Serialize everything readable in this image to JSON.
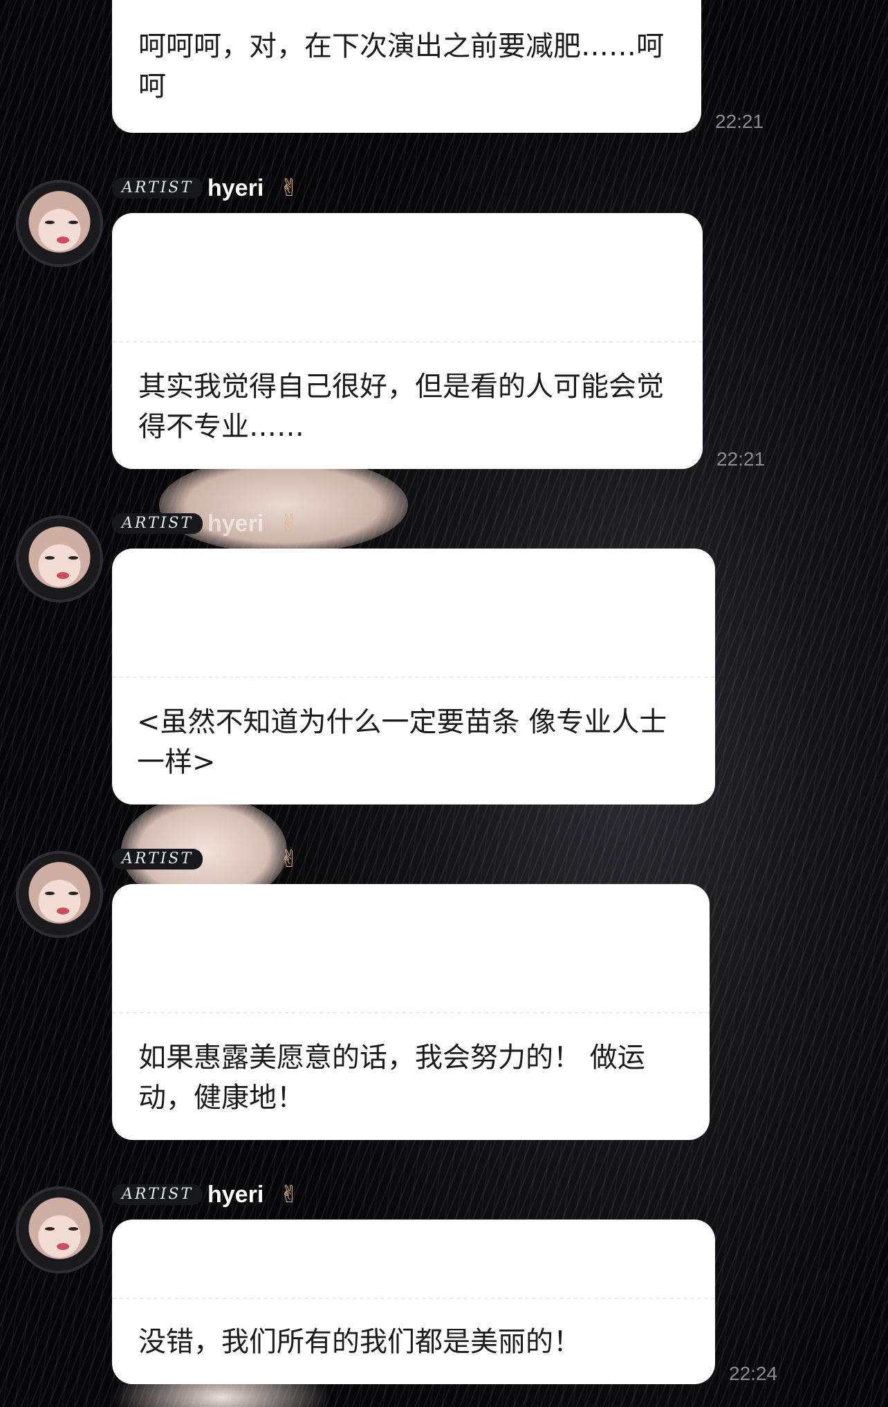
{
  "messages": [
    {
      "text": "呵呵呵，对，在下次演出之前要减肥……呵呵",
      "time": "22:21"
    },
    {
      "badge": "ARTIST",
      "sender": "hyeri",
      "sender_emoji": "✌",
      "text": "其实我觉得自己很好，但是看的人可能会觉得不专业……",
      "time": "22:21"
    },
    {
      "badge": "ARTIST",
      "sender": "hyeri",
      "sender_emoji": "✌",
      "text": "<虽然不知道为什么一定要苗条 像专业人士一样>"
    },
    {
      "badge": "ARTIST",
      "sender_emoji": "✌",
      "text": "如果惠露美愿意的话，我会努力的！ 做运动，健康地！"
    },
    {
      "badge": "ARTIST",
      "sender": "hyeri",
      "sender_emoji": "✌",
      "text": "没错，我们所有的我们都是美丽的！",
      "time": "22:24"
    }
  ]
}
